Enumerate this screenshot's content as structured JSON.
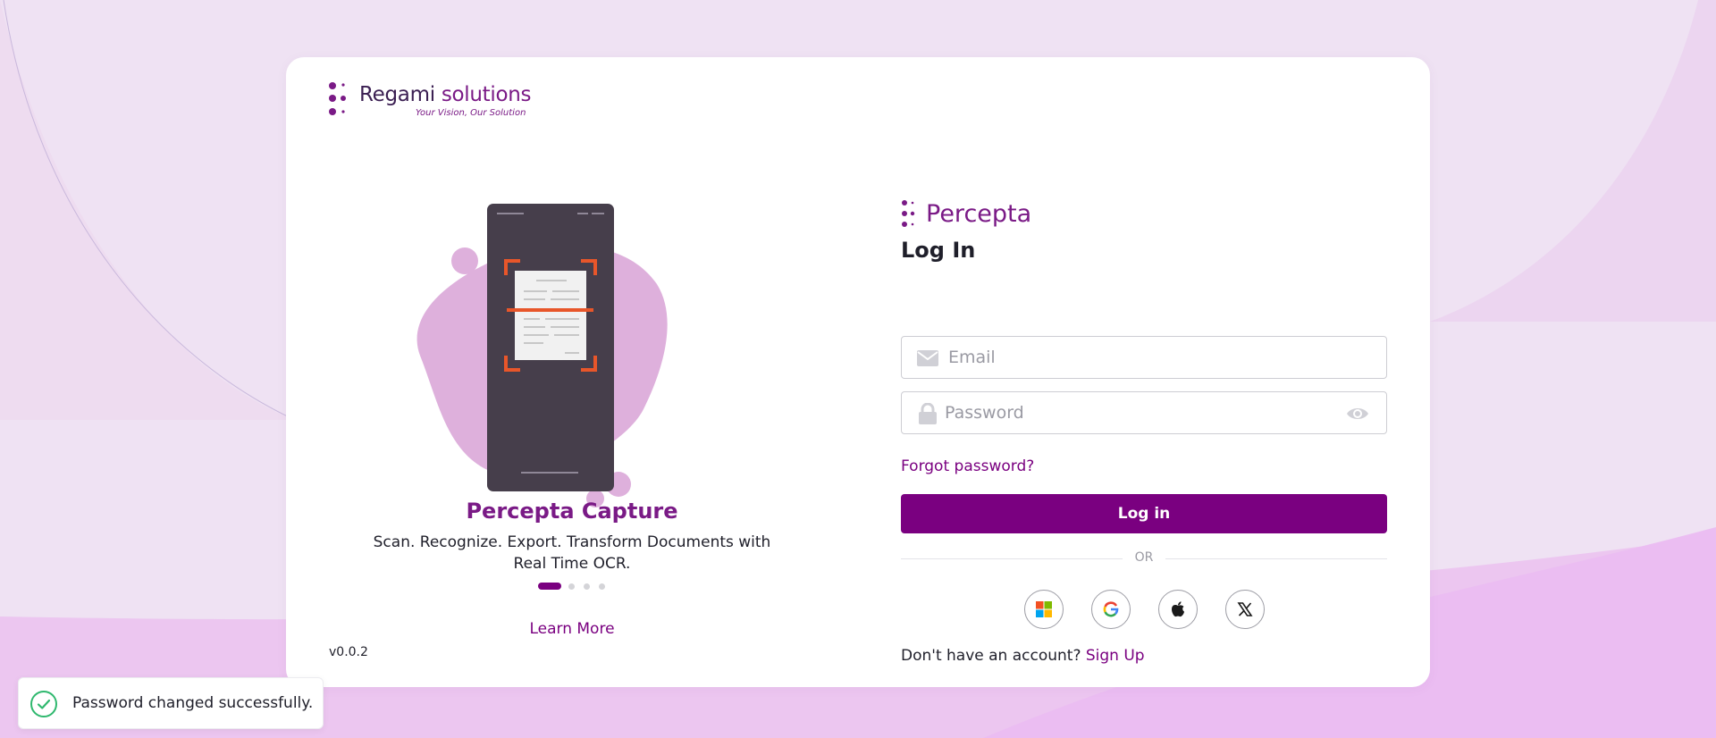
{
  "brand": {
    "name_part1": "Regami",
    "name_part2": "solutions",
    "tagline": "Your Vision, Our Solution"
  },
  "carousel": {
    "title": "Percepta Capture",
    "description": "Scan. Recognize. Export. Transform Documents with Real Time OCR.",
    "slide_count": 4,
    "active_slide": 1,
    "learn_more_label": "Learn More"
  },
  "version": "v0.0.2",
  "login": {
    "app_name": "Percepta",
    "title": "Log In",
    "email_placeholder": "Email",
    "password_placeholder": "Password",
    "forgot_label": "Forgot password?",
    "login_button_label": "Log in",
    "or_label": "OR",
    "social_buttons": [
      {
        "name": "microsoft",
        "icon": "microsoft-icon"
      },
      {
        "name": "google",
        "icon": "google-icon"
      },
      {
        "name": "apple",
        "icon": "apple-icon"
      },
      {
        "name": "x",
        "icon": "x-icon"
      }
    ],
    "signup_prompt": "Don't have an account?",
    "signup_label": "Sign Up"
  },
  "toast": {
    "message": "Password changed successfully.",
    "icon": "check-circle-icon"
  },
  "colors": {
    "primary": "#7a0080",
    "accent_orange": "#e8562a",
    "blob": "#deb0dc",
    "success": "#2fb86e"
  }
}
